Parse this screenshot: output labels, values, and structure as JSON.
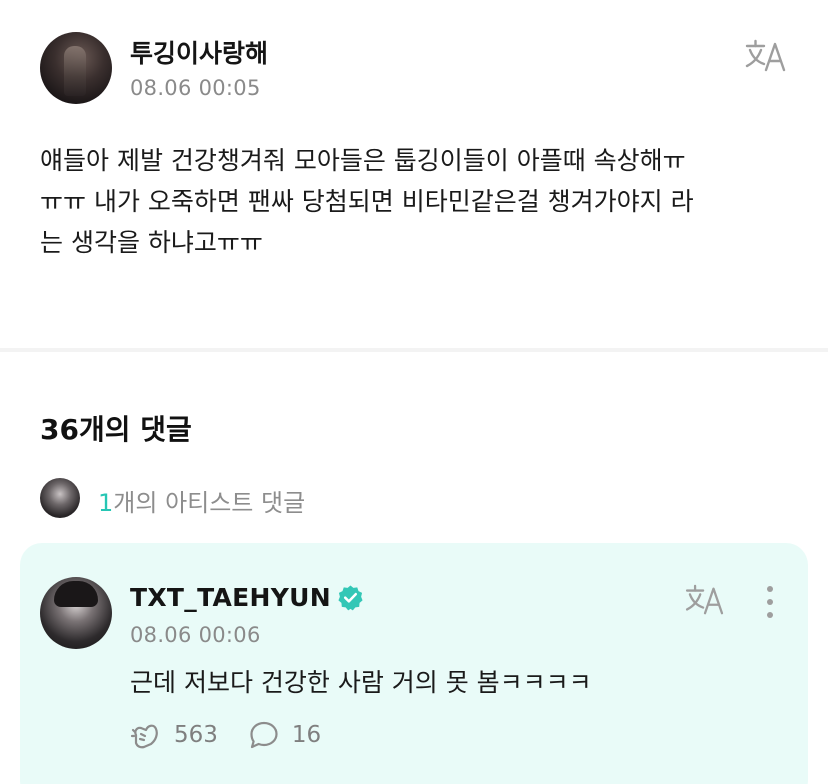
{
  "post": {
    "author_name": "투깅이사랑해",
    "timestamp": "08.06 00:05",
    "translate_icon": "translate-icon",
    "body_lines": [
      "얘들아 제발 건강챙겨줘 모아들은 툽깅이들이 아플때 속상해ㅠ",
      "ㅠㅠ 내가 오죽하면 팬싸 당첨되면 비타민같은걸 챙겨가야지 라",
      "는 생각을 하냐고ㅠㅠ"
    ]
  },
  "comments": {
    "count_label": "36개의 댓글",
    "artist_summary": {
      "count": "1",
      "label": "개의 아티스트 댓글"
    },
    "items": [
      {
        "author_name": "TXT_TAEHYUN",
        "verified": true,
        "timestamp": "08.06 00:06",
        "text": "근데 저보다 건강한 사람 거의 못 봄ㅋㅋㅋㅋ",
        "likes": "563",
        "replies": "16",
        "background": "#e9fbf8"
      }
    ]
  },
  "colors": {
    "accent_teal": "#26c6b4",
    "muted_text": "#8a8a8a",
    "divider": "#f3f3f3"
  }
}
